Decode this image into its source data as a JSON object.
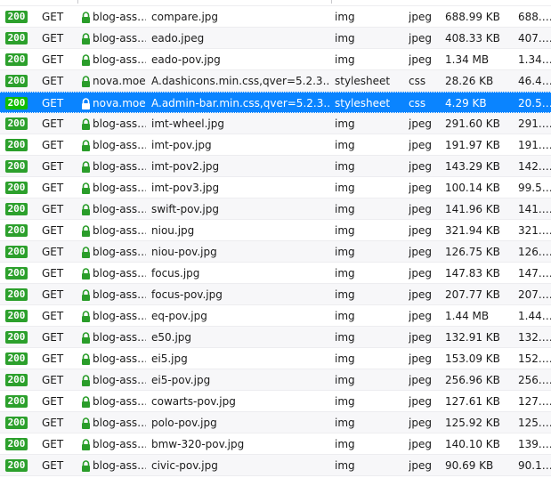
{
  "rows": [
    {
      "status": "200",
      "method": "GET",
      "domain": "blog-ass…",
      "file": "compare.jpg",
      "cause": "img",
      "type": "jpeg",
      "transferred": "688.99 KB",
      "size": "688.…"
    },
    {
      "status": "200",
      "method": "GET",
      "domain": "blog-ass…",
      "file": "eado.jpeg",
      "cause": "img",
      "type": "jpeg",
      "transferred": "408.33 KB",
      "size": "407.…"
    },
    {
      "status": "200",
      "method": "GET",
      "domain": "blog-ass…",
      "file": "eado-pov.jpg",
      "cause": "img",
      "type": "jpeg",
      "transferred": "1.34 MB",
      "size": "1.34…"
    },
    {
      "status": "200",
      "method": "GET",
      "domain": "nova.moe",
      "file": "A.dashicons.min.css,qver=5.2.3.…",
      "cause": "stylesheet",
      "type": "css",
      "transferred": "28.26 KB",
      "size": "46.4…"
    },
    {
      "status": "200",
      "method": "GET",
      "domain": "nova.moe",
      "file": "A.admin-bar.min.css,qver=5.2.3.…",
      "cause": "stylesheet",
      "type": "css",
      "transferred": "4.29 KB",
      "size": "20.5…",
      "selected": true
    },
    {
      "status": "200",
      "method": "GET",
      "domain": "blog-ass…",
      "file": "imt-wheel.jpg",
      "cause": "img",
      "type": "jpeg",
      "transferred": "291.60 KB",
      "size": "291.…"
    },
    {
      "status": "200",
      "method": "GET",
      "domain": "blog-ass…",
      "file": "imt-pov.jpg",
      "cause": "img",
      "type": "jpeg",
      "transferred": "191.97 KB",
      "size": "191.…"
    },
    {
      "status": "200",
      "method": "GET",
      "domain": "blog-ass…",
      "file": "imt-pov2.jpg",
      "cause": "img",
      "type": "jpeg",
      "transferred": "143.29 KB",
      "size": "142.…"
    },
    {
      "status": "200",
      "method": "GET",
      "domain": "blog-ass…",
      "file": "imt-pov3.jpg",
      "cause": "img",
      "type": "jpeg",
      "transferred": "100.14 KB",
      "size": "99.5…"
    },
    {
      "status": "200",
      "method": "GET",
      "domain": "blog-ass…",
      "file": "swift-pov.jpg",
      "cause": "img",
      "type": "jpeg",
      "transferred": "141.96 KB",
      "size": "141.…"
    },
    {
      "status": "200",
      "method": "GET",
      "domain": "blog-ass…",
      "file": "niou.jpg",
      "cause": "img",
      "type": "jpeg",
      "transferred": "321.94 KB",
      "size": "321.…"
    },
    {
      "status": "200",
      "method": "GET",
      "domain": "blog-ass…",
      "file": "niou-pov.jpg",
      "cause": "img",
      "type": "jpeg",
      "transferred": "126.75 KB",
      "size": "126.…"
    },
    {
      "status": "200",
      "method": "GET",
      "domain": "blog-ass…",
      "file": "focus.jpg",
      "cause": "img",
      "type": "jpeg",
      "transferred": "147.83 KB",
      "size": "147.…"
    },
    {
      "status": "200",
      "method": "GET",
      "domain": "blog-ass…",
      "file": "focus-pov.jpg",
      "cause": "img",
      "type": "jpeg",
      "transferred": "207.77 KB",
      "size": "207.…"
    },
    {
      "status": "200",
      "method": "GET",
      "domain": "blog-ass…",
      "file": "eq-pov.jpg",
      "cause": "img",
      "type": "jpeg",
      "transferred": "1.44 MB",
      "size": "1.44…"
    },
    {
      "status": "200",
      "method": "GET",
      "domain": "blog-ass…",
      "file": "e50.jpg",
      "cause": "img",
      "type": "jpeg",
      "transferred": "132.91 KB",
      "size": "132.…"
    },
    {
      "status": "200",
      "method": "GET",
      "domain": "blog-ass…",
      "file": "ei5.jpg",
      "cause": "img",
      "type": "jpeg",
      "transferred": "153.09 KB",
      "size": "152.…"
    },
    {
      "status": "200",
      "method": "GET",
      "domain": "blog-ass…",
      "file": "ei5-pov.jpg",
      "cause": "img",
      "type": "jpeg",
      "transferred": "256.96 KB",
      "size": "256.…"
    },
    {
      "status": "200",
      "method": "GET",
      "domain": "blog-ass…",
      "file": "cowarts-pov.jpg",
      "cause": "img",
      "type": "jpeg",
      "transferred": "127.61 KB",
      "size": "127.…"
    },
    {
      "status": "200",
      "method": "GET",
      "domain": "blog-ass…",
      "file": "polo-pov.jpg",
      "cause": "img",
      "type": "jpeg",
      "transferred": "125.92 KB",
      "size": "125.…"
    },
    {
      "status": "200",
      "method": "GET",
      "domain": "blog-ass…",
      "file": "bmw-320-pov.jpg",
      "cause": "img",
      "type": "jpeg",
      "transferred": "140.10 KB",
      "size": "139.…"
    },
    {
      "status": "200",
      "method": "GET",
      "domain": "blog-ass…",
      "file": "civic-pov.jpg",
      "cause": "img",
      "type": "jpeg",
      "transferred": "90.69 KB",
      "size": "90.1…"
    }
  ],
  "colors": {
    "status_ok": "#2ca02c",
    "selected_bg": "#0a84ff",
    "lock_icon": "#2a9d2a"
  },
  "icons": {
    "secure": "lock-icon"
  }
}
